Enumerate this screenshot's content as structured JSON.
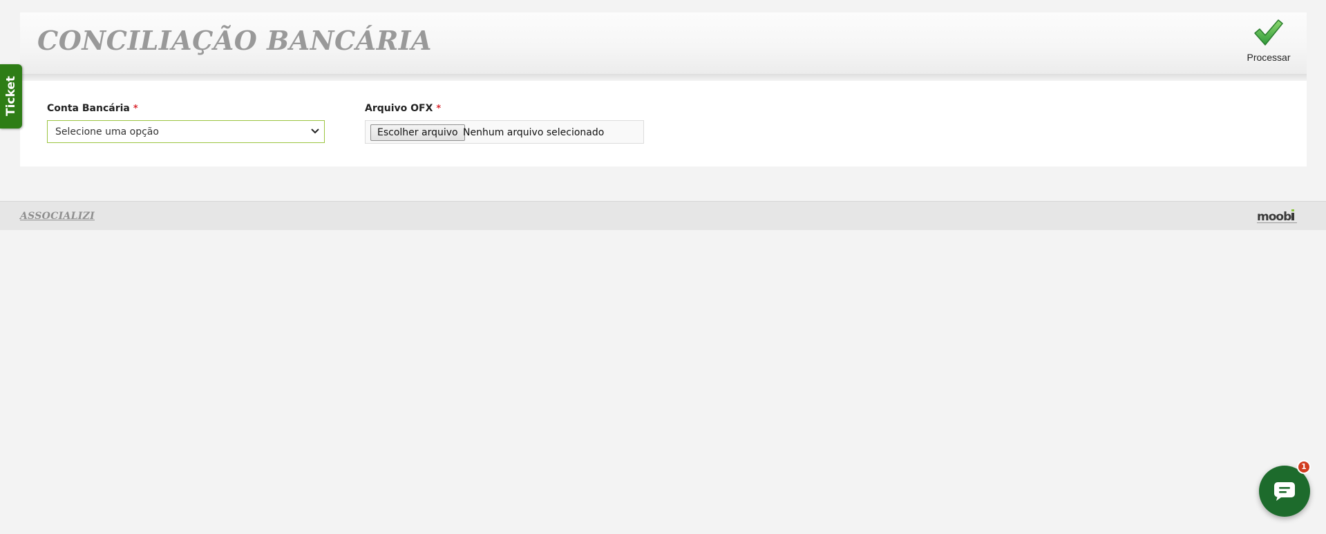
{
  "header": {
    "title": "CONCILIAÇÃO BANCÁRIA",
    "process_label": "Processar",
    "process_icon": "checkmark-icon"
  },
  "form": {
    "conta_bancaria": {
      "label": "Conta Bancária",
      "required_marker": "*",
      "selected_value": "Selecione uma opção",
      "dropdown_icon": "chevron-down-icon"
    },
    "arquivo_ofx": {
      "label": "Arquivo OFX",
      "required_marker": "*",
      "button_label": "Escolher arquivo",
      "status_text": "Nenhum arquivo selecionado"
    }
  },
  "footer": {
    "link_text": "ASSOCIALIZI",
    "logo_text": "moobi"
  },
  "ticket_tab": {
    "label": "Ticket"
  },
  "chat": {
    "icon": "chat-bubble-icon",
    "badge_count": "1"
  },
  "colors": {
    "accent_green": "#2e7d16",
    "chat_green": "#1d6b2c",
    "required_red": "#d9272e",
    "title_gray": "#999999",
    "select_border": "#9ac43f",
    "badge_red": "#d23c1f"
  }
}
